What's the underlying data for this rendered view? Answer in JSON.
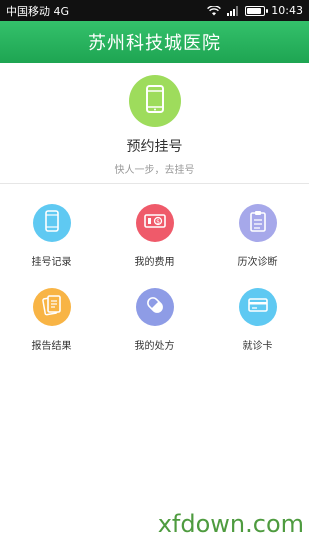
{
  "status_bar": {
    "carrier": "中国移动 4G",
    "time": "10:43",
    "battery_level": 0.85
  },
  "header": {
    "title": "苏州科技城医院"
  },
  "hero": {
    "title": "预约挂号",
    "subtitle": "快人一步，去挂号",
    "icon": "phone-icon",
    "color": "#9edc5c"
  },
  "menu": {
    "items": [
      {
        "label": "挂号记录",
        "icon": "phone-icon",
        "color": "#5fc9f2"
      },
      {
        "label": "我的费用",
        "icon": "money-icon",
        "color": "#ef5a6a"
      },
      {
        "label": "历次诊断",
        "icon": "clipboard-icon",
        "color": "#a6a8ea"
      },
      {
        "label": "报告结果",
        "icon": "report-icon",
        "color": "#f8b445"
      },
      {
        "label": "我的处方",
        "icon": "pill-icon",
        "color": "#8e9ce6"
      },
      {
        "label": "就诊卡",
        "icon": "card-icon",
        "color": "#5fc9f2"
      }
    ]
  },
  "watermark": "xfdown.com"
}
